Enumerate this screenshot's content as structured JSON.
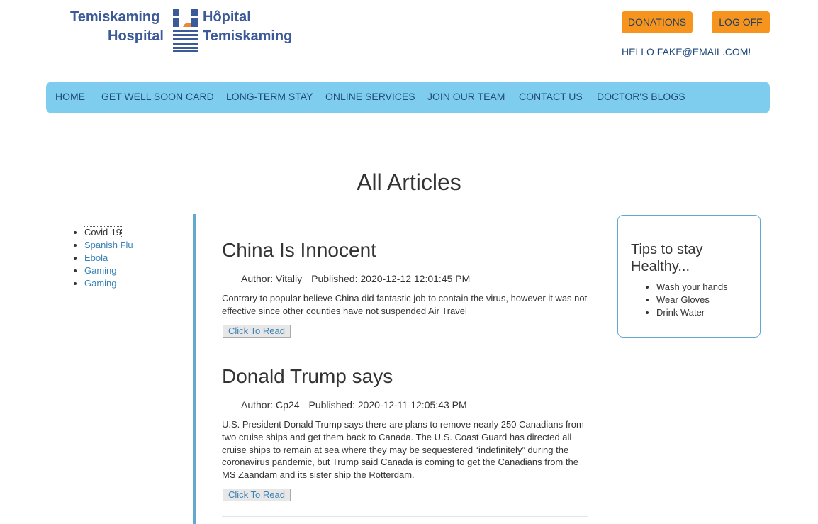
{
  "logo": {
    "en_line1": "Temiskaming",
    "en_line2": "Hospital",
    "fr_line1": "Hôpital",
    "fr_line2": "Temiskaming"
  },
  "header": {
    "donations_label": "DONATIONS",
    "logoff_label": "LOG OFF",
    "greeting": "HELLO FAKE@EMAIL.COM!"
  },
  "nav": {
    "items": [
      {
        "label": "HOME"
      },
      {
        "label": "GET WELL SOON CARD"
      },
      {
        "label": "LONG-TERM STAY"
      },
      {
        "label": "ONLINE SERVICES"
      },
      {
        "label": "JOIN OUR TEAM"
      },
      {
        "label": "CONTACT US"
      },
      {
        "label": "DOCTOR'S BLOGS"
      }
    ]
  },
  "page": {
    "title": "All Articles"
  },
  "categories": [
    {
      "label": "Covid-19"
    },
    {
      "label": "Spanish Flu"
    },
    {
      "label": "Ebola"
    },
    {
      "label": "Gaming"
    },
    {
      "label": "Gaming"
    }
  ],
  "articles": [
    {
      "title": "China Is Innocent",
      "author": "Author: Vitaliy",
      "published": "Published: 2020-12-12 12:01:45 PM",
      "body": "Contrary to popular believe China did fantastic job to contain the virus, however it was not effective since other counties have not suspended Air Travel",
      "read_label": "Click To Read"
    },
    {
      "title": "Donald Trump says",
      "author": "Author: Cp24",
      "published": "Published: 2020-12-11 12:05:43 PM",
      "body": "U.S. President Donald Trump says there are plans to remove nearly 250 Canadians from two cruise ships and get them back to Canada. The U.S. Coast Guard has directed all cruise ships to remain at sea where they may be sequestered “indefinitely” during the coronavirus pandemic, but Trump said Canada is coming to get the Canadians from the MS Zaandam and its sister ship the Rotterdam.",
      "read_label": "Click To Read"
    }
  ],
  "tips": {
    "title": "Tips to stay Healthy...",
    "items": [
      "Wash your hands",
      "Wear Gloves",
      "Drink Water"
    ]
  },
  "colors": {
    "nav_bg": "#7ecdee",
    "button_orange": "#f7941d",
    "link_blue": "#3a82b6",
    "accent_border": "#62a8cf",
    "logo_blue": "#3d5a98"
  }
}
